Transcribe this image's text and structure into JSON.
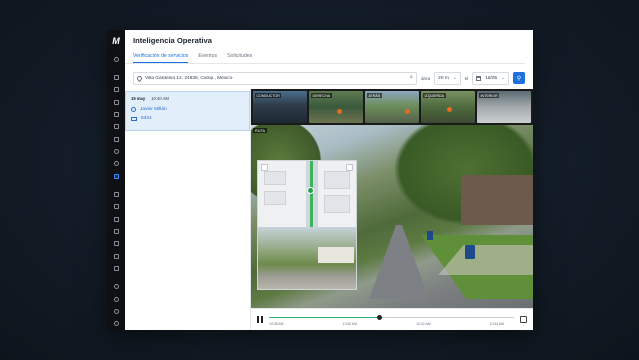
{
  "app": {
    "logo": "M",
    "title": "Inteligencia Operativa"
  },
  "tabs": [
    {
      "label": "Verificación de servicios",
      "active": true
    },
    {
      "label": "Eventos",
      "active": false
    },
    {
      "label": "Solicitudes",
      "active": false
    }
  ],
  "filters": {
    "search_value": "Villa Gardenia 12, 24839, Camp., México",
    "area_label": "área",
    "radius_value": "20 m",
    "date_label": "el",
    "date_value": "15/05"
  },
  "result_card": {
    "date": "15 may",
    "time": "10:40 AM",
    "driver": "Javier Millán",
    "vehicle": "5324"
  },
  "cameras": [
    {
      "label": "CONDUCTOR"
    },
    {
      "label": "DERECHA"
    },
    {
      "label": "ATRÁS"
    },
    {
      "label": "IZQUIERDA"
    },
    {
      "label": "INTERIOR"
    }
  ],
  "video": {
    "route_label": "RUTA"
  },
  "timeline": {
    "progress": 0.45,
    "ticks": [
      "10:38 AM",
      "10:40 AM",
      "10:42 AM",
      "10:44 AM"
    ]
  },
  "colors": {
    "accent": "#1e6fe0",
    "rail": "#0f1014",
    "route": "#2bb673"
  },
  "rail_icons": [
    "grid-icon",
    "map-icon",
    "shield-icon",
    "image-icon",
    "box-icon",
    "camera-icon",
    "tag-icon",
    "user-icon",
    "pin-icon",
    "chart-icon",
    "doc-icon",
    "layers-icon",
    "list-icon",
    "slider-icon",
    "calendar-icon",
    "archive-icon",
    "help-icon",
    "person-icon",
    "clock-icon",
    "bell-icon",
    "settings-icon"
  ]
}
